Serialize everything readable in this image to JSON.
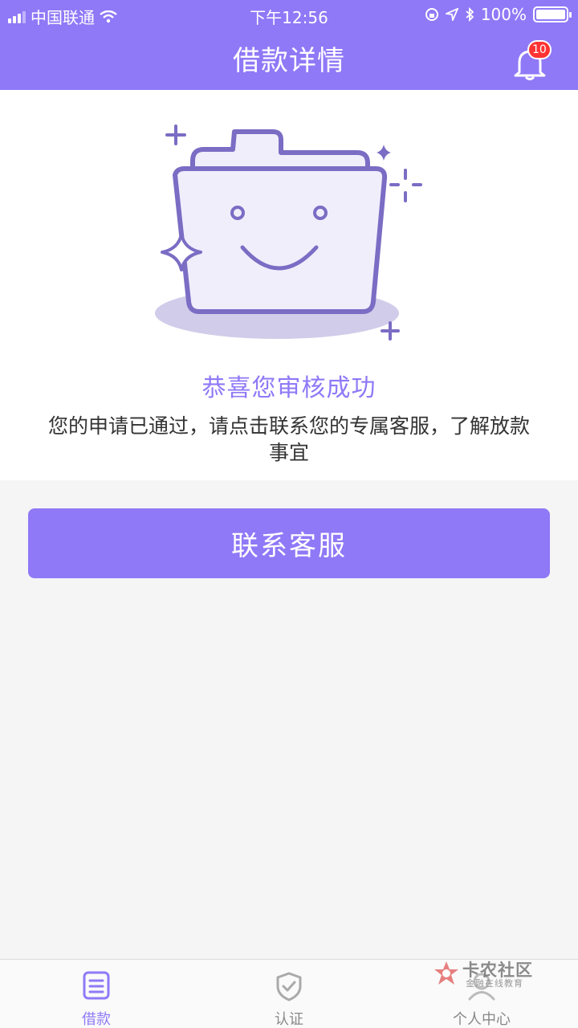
{
  "status_bar": {
    "carrier": "中国联通",
    "time": "下午12:56",
    "battery": "100%",
    "battery_level": 1.0
  },
  "header": {
    "title": "借款详情",
    "notification_count": "10"
  },
  "result": {
    "title": "恭喜您审核成功",
    "description": "您的申请已通过，请点击联系您的专属客服，了解放款事宜"
  },
  "actions": {
    "contact_label": "联系客服"
  },
  "tabbar": {
    "items": [
      {
        "label": "借款",
        "icon": "document-list-icon",
        "active": true
      },
      {
        "label": "认证",
        "icon": "shield-check-icon",
        "active": false
      },
      {
        "label": "个人中心",
        "icon": "user-icon",
        "active": false
      }
    ]
  },
  "watermark": {
    "title": "卡农社区",
    "subtitle": "金融在线教育"
  },
  "colors": {
    "primary": "#8f79f7",
    "illustration_stroke": "#7b6cc4",
    "badge": "#ff3333",
    "page_background": "#f5f5f5"
  }
}
